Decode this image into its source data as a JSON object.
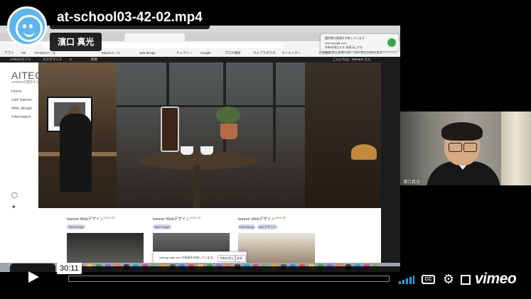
{
  "video": {
    "title": "at-school03-42-02.mp4",
    "byline": "濱口 真光",
    "time_display": "30:11",
    "progress": 0.0,
    "volume_level": 1.0,
    "brand": "vimeo"
  },
  "screen": {
    "wp_admin": {
      "site": "AITECHカフェ",
      "customize": "カスタマイズ",
      "count": "0",
      "new": "新規",
      "greeting": "こんにちは、hamaen さん"
    },
    "bookmarks": [
      "アプリ",
      "YB",
      "TAHOOIメール",
      "Tahoo!メール",
      "web design",
      "ギャラリー",
      "Google",
      "ブログ検索",
      "ウェブラボラボ",
      "クリエイター",
      "その他のブックマーク",
      "リーディングリスト"
    ],
    "notification": {
      "line1": "選択肢の画面を共有しています",
      "line2": "meet.google.com",
      "line3": "共有を停止する 非表示にする"
    },
    "site": {
      "title": "AITECHカフェ",
      "subtitle": "AITECHが運営するカフェ",
      "nav": [
        "Home",
        "cafe banner",
        "Web design",
        "Information"
      ]
    },
    "cards": [
      {
        "title": "banner Webデザイン",
        "tag": "view all",
        "pills": [
          "Web Design"
        ]
      },
      {
        "title": "banner Webデザイン",
        "tag": "view all",
        "pills": [
          "Web Design"
        ]
      },
      {
        "title": "banner Webデザイン",
        "tag": "view all",
        "pills": [
          "Web Design",
          "web デザイン"
        ]
      }
    ],
    "share_popup": {
      "message": "meet.google.com が画面を共有しています。",
      "stop": "共有を停止",
      "hide": "非表示"
    }
  },
  "webcam": {
    "name": "濱口真光"
  },
  "colors": {
    "accent": "#00adef",
    "avatar": "#5fb6ef",
    "overlay": "#000000"
  },
  "icons": {
    "play": "play-icon",
    "volume": "volume-icon",
    "cc": "closed-captions-icon",
    "settings": "gear-icon",
    "fullscreen": "fullscreen-icon"
  }
}
